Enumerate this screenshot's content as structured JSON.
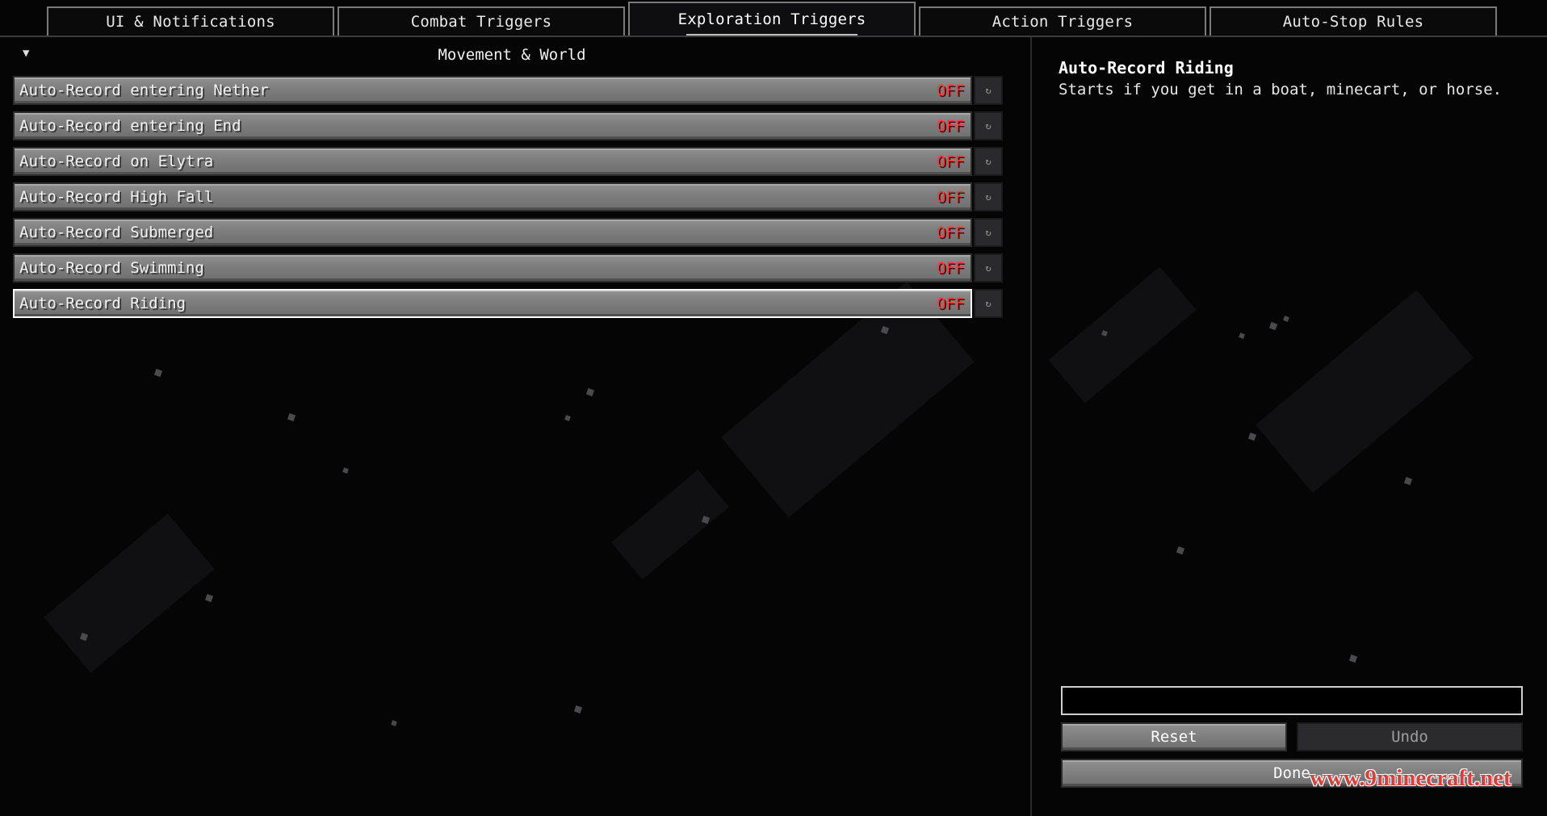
{
  "tabs": [
    {
      "label": "UI & Notifications"
    },
    {
      "label": "Combat Triggers"
    },
    {
      "label": "Exploration Triggers"
    },
    {
      "label": "Action Triggers"
    },
    {
      "label": "Auto-Stop Rules"
    }
  ],
  "active_tab": "Exploration Triggers",
  "section": {
    "title": "Movement & World",
    "collapse_icon": "triangle-down-icon"
  },
  "options": [
    {
      "label": "Auto-Record entering Nether",
      "value": "OFF"
    },
    {
      "label": "Auto-Record entering End",
      "value": "OFF"
    },
    {
      "label": "Auto-Record on Elytra",
      "value": "OFF"
    },
    {
      "label": "Auto-Record High Fall",
      "value": "OFF"
    },
    {
      "label": "Auto-Record Submerged",
      "value": "OFF"
    },
    {
      "label": "Auto-Record Swimming",
      "value": "OFF"
    },
    {
      "label": "Auto-Record Riding",
      "value": "OFF"
    }
  ],
  "option_reset_icon": "reset-icon",
  "selected_option": "Auto-Record Riding",
  "info": {
    "title": "Auto-Record Riding",
    "description": "Starts if you get in a boat, minecart, or horse."
  },
  "search": {
    "value": "",
    "placeholder": ""
  },
  "buttons": {
    "reset": "Reset",
    "undo": "Undo",
    "done": "Done"
  },
  "watermark": "www.9minecraft.net",
  "colors": {
    "off_value": "#ff3b3b",
    "background": "#050506",
    "button": "#7d7d7d"
  }
}
